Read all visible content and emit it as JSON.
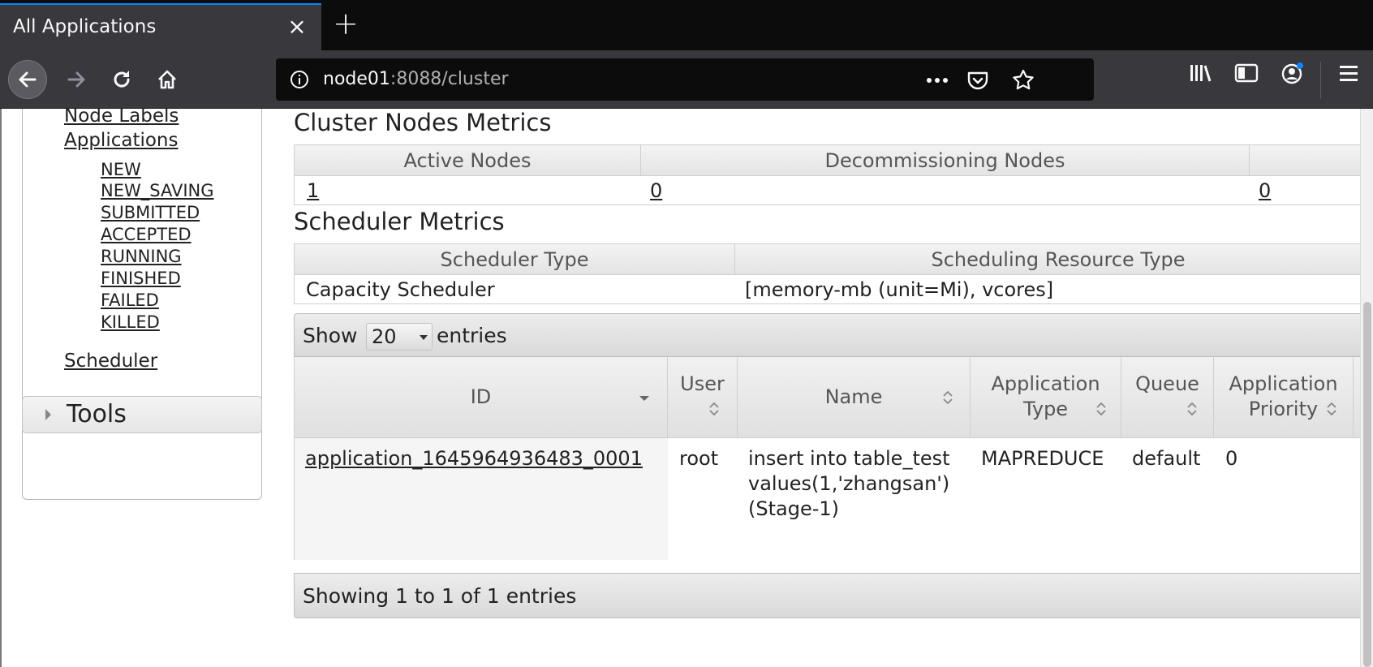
{
  "browser": {
    "tab_title": "All Applications",
    "url_host": "node01",
    "url_path": ":8088/cluster"
  },
  "sidebar": {
    "node_labels": "Node Labels",
    "applications": "Applications",
    "app_states": [
      "NEW",
      "NEW_SAVING",
      "SUBMITTED",
      "ACCEPTED",
      "RUNNING",
      "FINISHED",
      "FAILED",
      "KILLED"
    ],
    "scheduler": "Scheduler",
    "tools": "Tools"
  },
  "cluster_nodes": {
    "title": "Cluster Nodes Metrics",
    "headers": [
      "Active Nodes",
      "Decommissioning Nodes"
    ],
    "values": [
      "1",
      "0",
      "0"
    ]
  },
  "scheduler_metrics": {
    "title": "Scheduler Metrics",
    "headers": [
      "Scheduler Type",
      "Scheduling Resource Type"
    ],
    "values": [
      "Capacity Scheduler",
      "[memory-mb (unit=Mi), vcores]"
    ]
  },
  "apps_table": {
    "show_label": "Show",
    "page_size": "20",
    "entries_label": "entries",
    "columns": {
      "id": "ID",
      "user": "User",
      "name": "Name",
      "app_type_1": "Application",
      "app_type_2": "Type",
      "queue": "Queue",
      "priority_1": "Application",
      "priority_2": "Priority"
    },
    "rows": [
      {
        "id": "application_1645964936483_0001",
        "user": "root",
        "name_lines": [
          "insert into table_test",
          "values(1,'zhangsan')",
          "(Stage-1)"
        ],
        "type": "MAPREDUCE",
        "queue": "default",
        "priority": "0"
      }
    ],
    "info": "Showing 1 to 1 of 1 entries"
  },
  "colors": {
    "chrome_dark": "#0c0c0d",
    "chrome_toolbar": "#38383d",
    "tab_accent": "#0a84ff"
  },
  "icons": [
    "close-icon",
    "plus-icon",
    "back-arrow-icon",
    "forward-arrow-icon",
    "reload-icon",
    "home-icon",
    "info-icon",
    "more-icon",
    "pocket-icon",
    "bookmark-star-icon",
    "library-icon",
    "sidebar-icon",
    "account-icon",
    "menu-icon",
    "sort-icon",
    "sort-desc-icon",
    "chevron-right-icon"
  ]
}
